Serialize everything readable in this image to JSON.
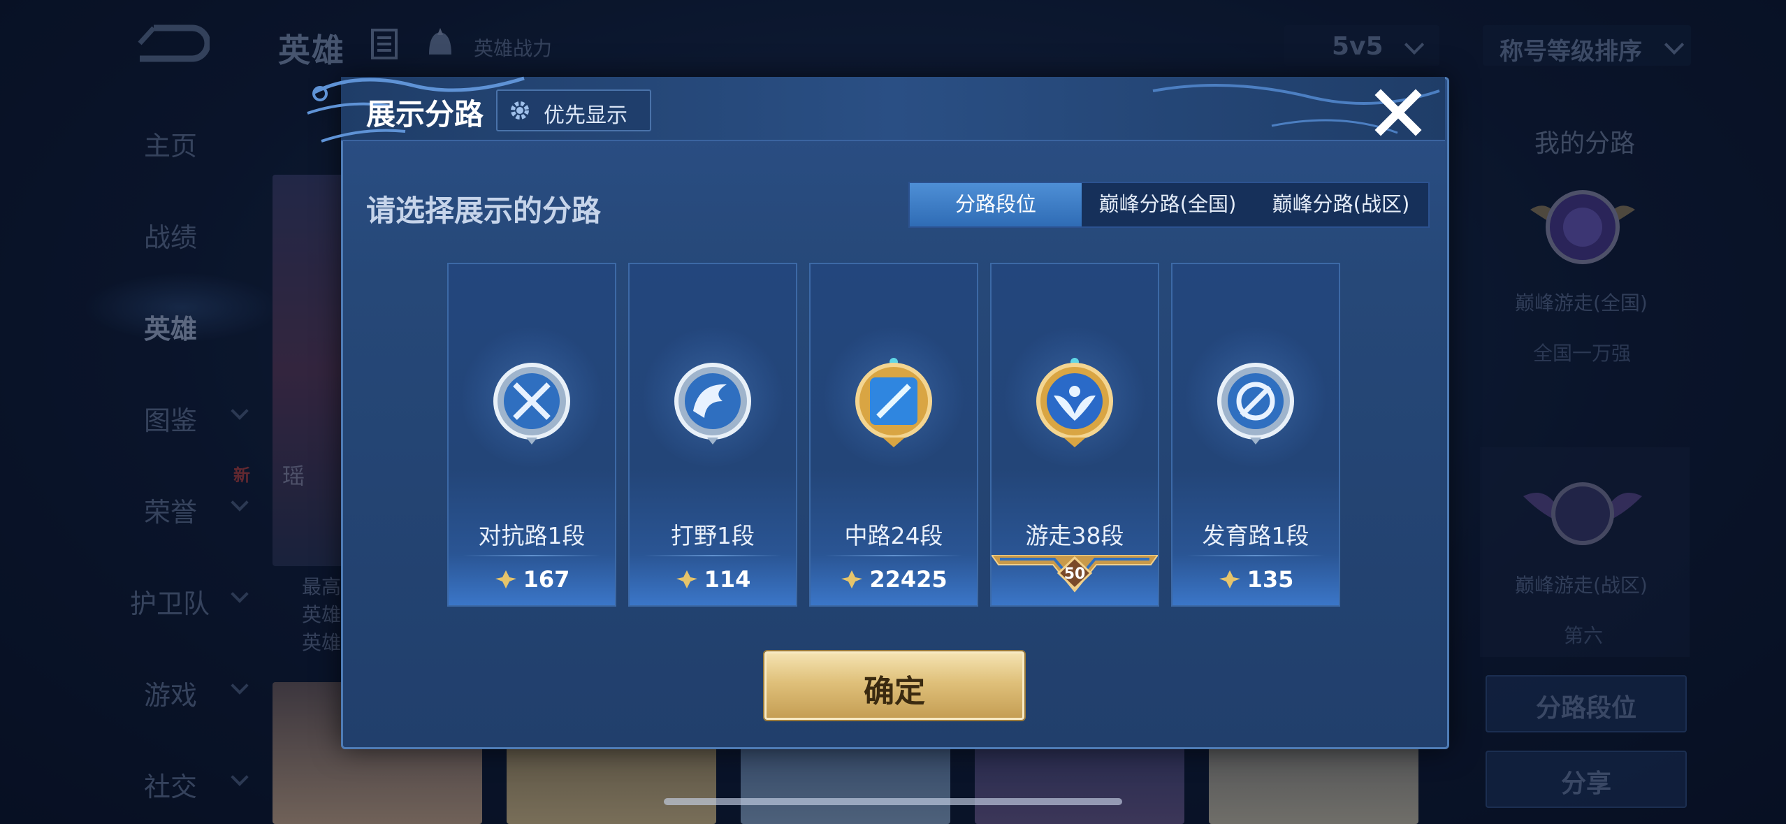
{
  "background": {
    "page_title": "英雄",
    "power_label": "英雄战力",
    "mode_select": "5v5",
    "sort_select": "称号等级排序",
    "sidebar": [
      {
        "label": "主页",
        "active": false,
        "has_arrow": false
      },
      {
        "label": "战绩",
        "active": false,
        "has_arrow": false
      },
      {
        "label": "英雄",
        "active": true,
        "has_arrow": false
      },
      {
        "label": "图鉴",
        "active": false,
        "has_arrow": true
      },
      {
        "label": "荣誉",
        "active": false,
        "has_arrow": true
      },
      {
        "label": "护卫队",
        "active": false,
        "has_arrow": true
      },
      {
        "label": "游戏",
        "active": false,
        "has_arrow": true
      },
      {
        "label": "社交",
        "active": false,
        "has_arrow": true
      }
    ],
    "new_badge": "新",
    "hero_name": "瑶",
    "hero_desc": [
      "最高",
      "英雄",
      "英雄"
    ],
    "right_panel": {
      "title": "我的分路",
      "lane1_label": "巅峰游走(全国)",
      "lane1_sub": "全国一万强",
      "lane2_label": "巅峰游走(战区)",
      "lane2_sub": "第六",
      "btn_lane_rank": "分路段位",
      "btn_share": "分享"
    }
  },
  "modal": {
    "title": "展示分路",
    "priority_button": "优先显示",
    "subtitle": "请选择展示的分路",
    "tabs": [
      {
        "label": "分路段位",
        "active": true
      },
      {
        "label": "巅峰分路(全国)",
        "active": false
      },
      {
        "label": "巅峰分路(战区)",
        "active": false
      }
    ],
    "lanes": [
      {
        "name": "对抗路1段",
        "score": "167",
        "emblem": "silver-crossed-swords-icon"
      },
      {
        "name": "打野1段",
        "score": "114",
        "emblem": "silver-dragon-icon"
      },
      {
        "name": "中路24段",
        "score": "22425",
        "emblem": "gold-staff-icon"
      },
      {
        "name": "游走38段",
        "rank_badge": "50",
        "emblem": "gold-winged-shield-icon"
      },
      {
        "name": "发育路1段",
        "score": "135",
        "emblem": "silver-target-icon"
      }
    ],
    "confirm_button": "确定"
  },
  "colors": {
    "modal_bg": "#264878",
    "tab_active": "#3f7ec6",
    "confirm_gold": "#dfc07a",
    "score_star": "#e6c46a"
  }
}
